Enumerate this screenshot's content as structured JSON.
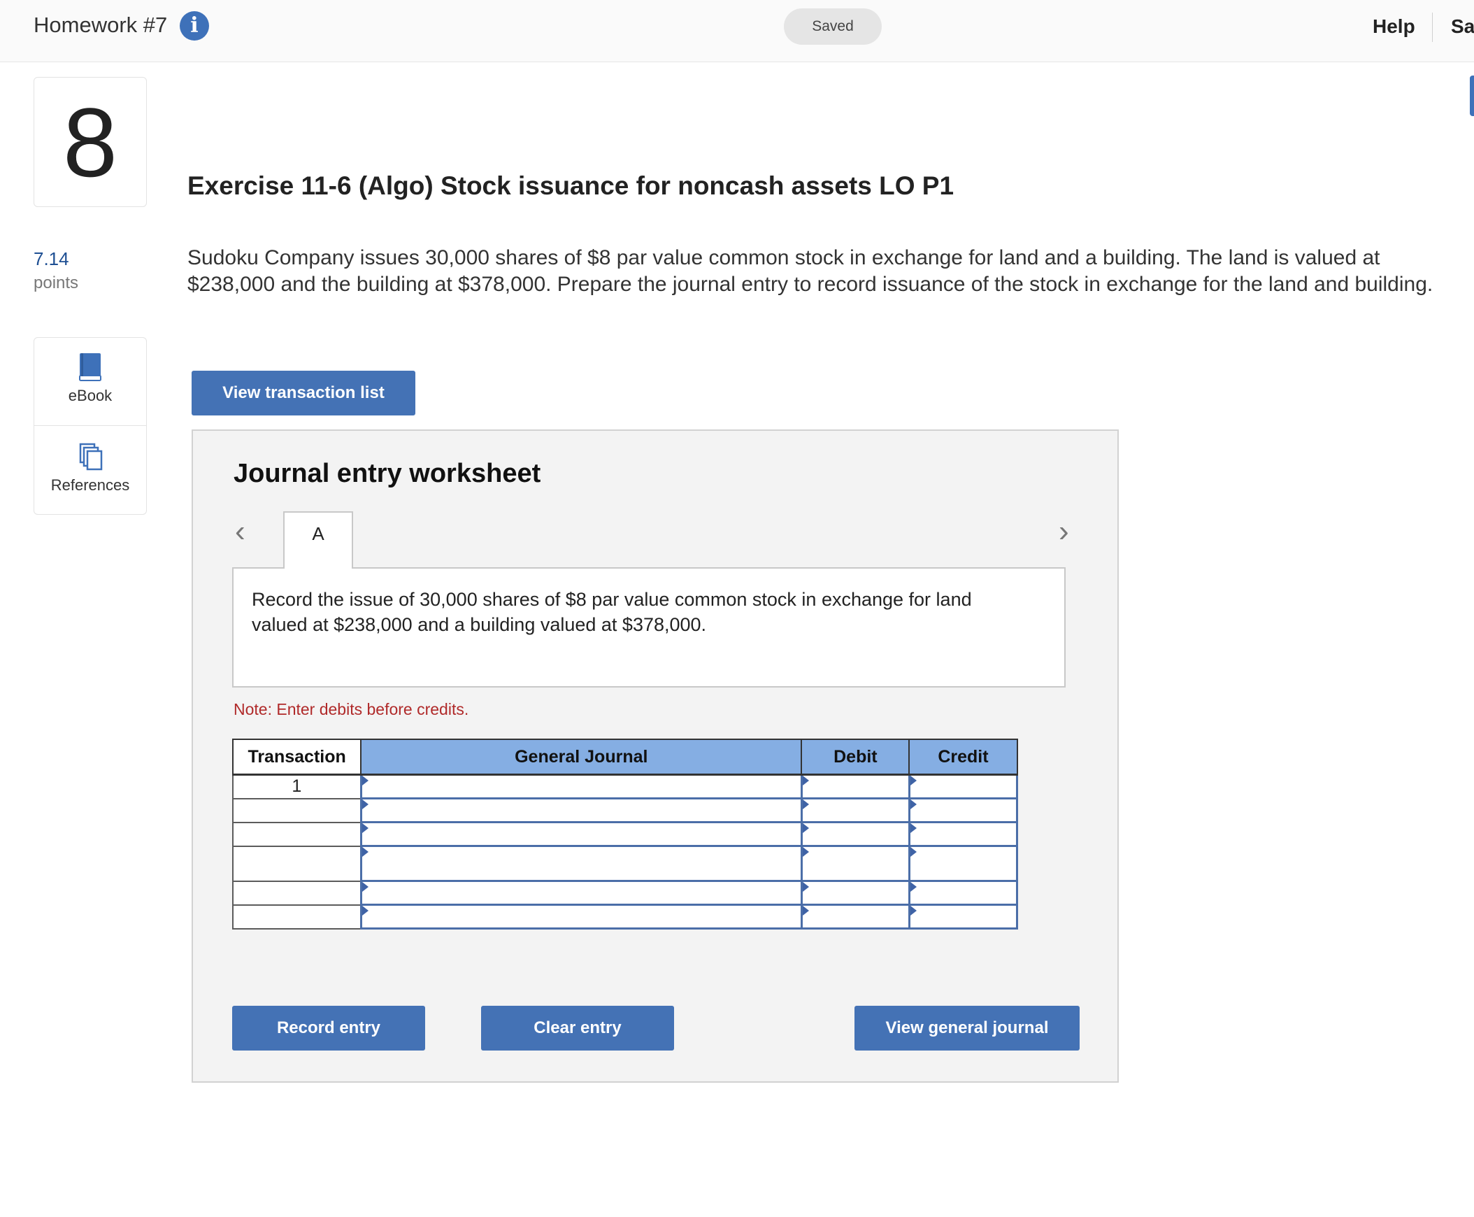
{
  "header": {
    "homework_title": "Homework #7",
    "info_icon": "info-icon",
    "status": "Saved",
    "help": "Help",
    "save_exit": "Sa"
  },
  "question": {
    "number": "8",
    "points_value": "7.14",
    "points_label": "points",
    "title": "Exercise 11-6 (Algo) Stock issuance for noncash assets LO P1",
    "prompt": "Sudoku Company issues 30,000 shares of $8 par value common stock in exchange for land and a building. The land is valued at $238,000 and the building at $378,000. Prepare the journal entry to record issuance of the stock in exchange for the land and building."
  },
  "tools": [
    {
      "label": "eBook",
      "icon": "book-icon"
    },
    {
      "label": "References",
      "icon": "copy-pages-icon"
    }
  ],
  "buttons": {
    "view_transaction_list": "View transaction list",
    "record_entry": "Record entry",
    "clear_entry": "Clear entry",
    "view_general_journal": "View general journal"
  },
  "worksheet": {
    "title": "Journal entry worksheet",
    "prev_icon": "chevron-left-icon",
    "next_icon": "chevron-right-icon",
    "tabs": [
      {
        "label": "A"
      }
    ],
    "instruction": "Record the issue of 30,000 shares of $8 par value common stock in exchange for land valued at $238,000 and a building valued at $378,000.",
    "note": "Note: Enter debits before credits."
  },
  "journal": {
    "columns": [
      "Transaction",
      "General Journal",
      "Debit",
      "Credit"
    ],
    "rows": [
      {
        "transaction": "1",
        "account": "",
        "debit": "",
        "credit": ""
      },
      {
        "transaction": "",
        "account": "",
        "debit": "",
        "credit": ""
      },
      {
        "transaction": "",
        "account": "",
        "debit": "",
        "credit": ""
      },
      {
        "transaction": "",
        "account": "",
        "debit": "",
        "credit": ""
      },
      {
        "transaction": "",
        "account": "",
        "debit": "",
        "credit": ""
      },
      {
        "transaction": "",
        "account": "",
        "debit": "",
        "credit": ""
      }
    ]
  },
  "colors": {
    "accent": "#4472b5",
    "header_blue": "#85aee3",
    "note_red": "#b02a2a",
    "points_blue": "#1e4f93"
  }
}
